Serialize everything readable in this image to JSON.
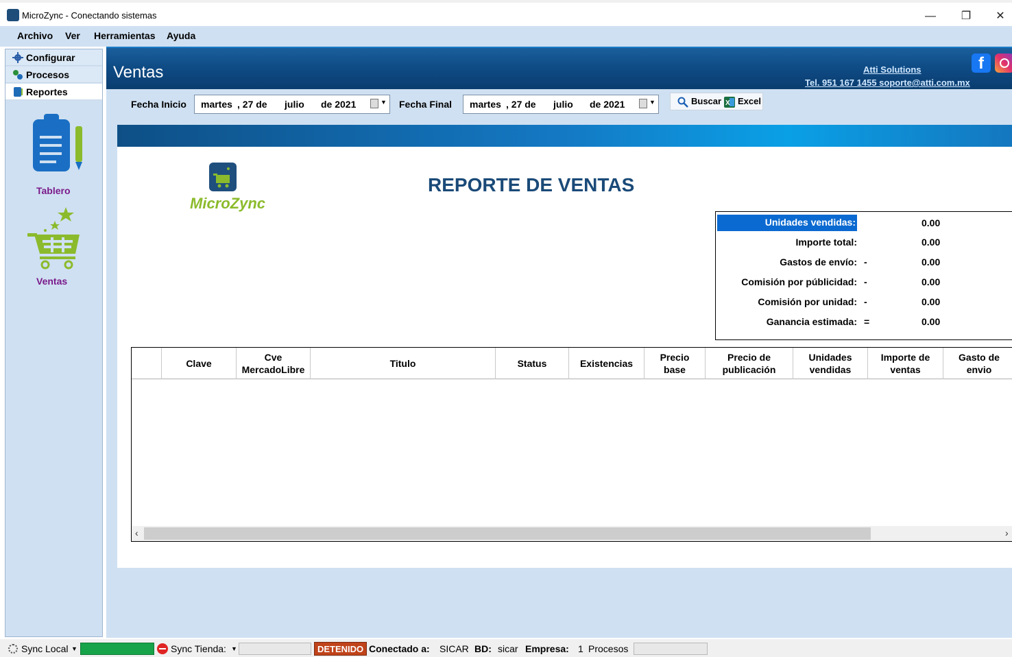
{
  "window": {
    "title": "MicroZync - Conectando sistemas",
    "minimize": "—",
    "maximize": "❐",
    "close": "✕"
  },
  "menu": [
    "Archivo",
    "Ver",
    "Herramientas",
    "Ayuda"
  ],
  "leftnav": {
    "top_items": [
      {
        "label": "Configurar",
        "icon": "gear-icon"
      },
      {
        "label": "Procesos",
        "icon": "process-icon"
      },
      {
        "label": "Reportes",
        "icon": "report-icon"
      }
    ],
    "tiles": [
      {
        "label": "Tablero",
        "icon": "clipboard-icon"
      },
      {
        "label": "Ventas",
        "icon": "cart-icon"
      }
    ]
  },
  "header": {
    "title": "Ventas",
    "company": "Atti Solutions",
    "contact": "Tel. 951 167 1455  soporte@atti.com.mx",
    "facebook": "f"
  },
  "filters": {
    "start_label": "Fecha Inicio",
    "end_label": "Fecha Final",
    "start": {
      "day_name": "martes",
      "day": ", 27 de",
      "month": "julio",
      "year": "de 2021"
    },
    "end": {
      "day_name": "martes",
      "day": ", 27 de",
      "month": "julio",
      "year": "de 2021"
    },
    "search_label": "Buscar",
    "excel_label": "Excel"
  },
  "report": {
    "logo_text": "MicroZync",
    "title": "REPORTE DE VENTAS",
    "summary": [
      {
        "label": "Unidades vendidas:",
        "op": "",
        "value": "0.00",
        "highlight": true
      },
      {
        "label": "Importe total:",
        "op": "",
        "value": "0.00"
      },
      {
        "label": "Gastos de envío:",
        "op": "-",
        "value": "0.00"
      },
      {
        "label": "Comisión por públicidad:",
        "op": "-",
        "value": "0.00"
      },
      {
        "label": "Comisión por unidad:",
        "op": "-",
        "value": "0.00"
      },
      {
        "label": "Ganancia estimada:",
        "op": "=",
        "value": "0.00"
      }
    ],
    "columns": [
      "",
      "Clave",
      "Cve MercadoLibre",
      "Titulo",
      "Status",
      "Existencias",
      "Precio base",
      "Precio de publicación",
      "Unidades vendidas",
      "Importe de ventas",
      "Gasto de envio"
    ],
    "rows": []
  },
  "status": {
    "sync_local": "Sync Local",
    "sync_tienda": "Sync Tienda:",
    "state": "DETENIDO",
    "connected_label": "Conectado a:",
    "connected_value": "SICAR",
    "db_label": "BD:",
    "db_value": "sicar",
    "company_label": "Empresa:",
    "company_value": "1",
    "processes_label": "Procesos"
  }
}
